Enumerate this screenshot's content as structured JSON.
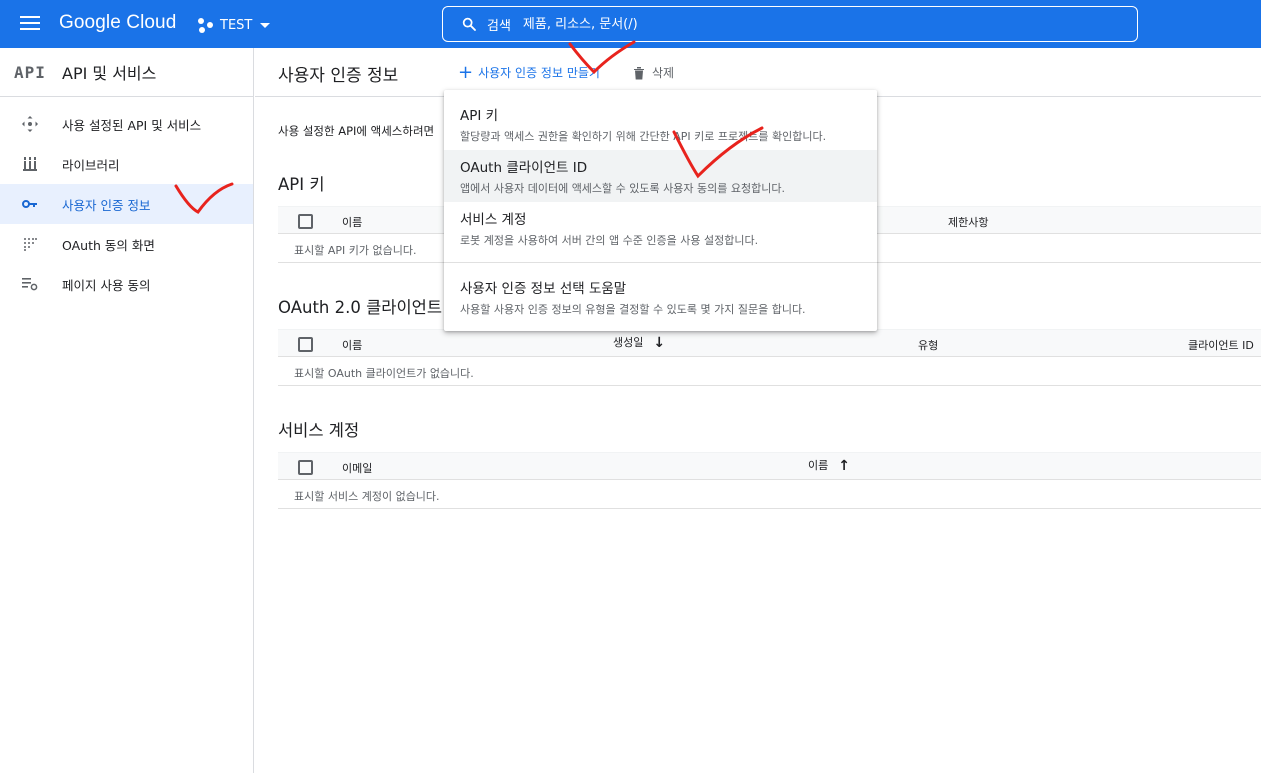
{
  "topbar": {
    "logo": "Google Cloud",
    "project": "TEST",
    "search_label": "검색",
    "search_placeholder": "제품, 리소스, 문서(/)"
  },
  "sidebar": {
    "logo_text": "API",
    "title": "API 및 서비스",
    "items": [
      {
        "label": "사용 설정된 API 및 서비스",
        "icon": "services-icon"
      },
      {
        "label": "라이브러리",
        "icon": "library-icon"
      },
      {
        "label": "사용자 인증 정보",
        "icon": "key-icon",
        "active": true
      },
      {
        "label": "OAuth 동의 화면",
        "icon": "oauth-consent-icon"
      },
      {
        "label": "페이지 사용 동의",
        "icon": "page-usage-icon"
      }
    ]
  },
  "main": {
    "title": "사용자 인증 정보",
    "create_label": "사용자 인증 정보 만들기",
    "delete_label": "삭제",
    "intro": "사용 설정한 API에 액세스하려면",
    "api_keys": {
      "title": "API 키",
      "columns": [
        "이름",
        "제한사항"
      ],
      "empty": "표시할 API 키가 없습니다."
    },
    "oauth": {
      "title": "OAuth 2.0 클라이언트",
      "columns": [
        "이름",
        "생성일",
        "유형",
        "클라이언트 ID"
      ],
      "empty": "표시할 OAuth 클라이언트가 없습니다."
    },
    "service_accounts": {
      "title": "서비스 계정",
      "columns": [
        "이메일",
        "이름"
      ],
      "empty": "표시할 서비스 계정이 없습니다."
    }
  },
  "menu": {
    "items": [
      {
        "title": "API 키",
        "desc": "할당량과 액세스 권한을 확인하기 위해 간단한 API 키로 프로젝트를 확인합니다."
      },
      {
        "title": "OAuth 클라이언트 ID",
        "desc": "앱에서 사용자 데이터에 액세스할 수 있도록 사용자 동의를 요청합니다."
      },
      {
        "title": "서비스 계정",
        "desc": "로봇 계정을 사용하여 서버 간의 앱 수준 인증을 사용 설정합니다."
      },
      {
        "title": "사용자 인증 정보 선택 도움말",
        "desc": "사용할 사용자 인증 정보의 유형을 결정할 수 있도록 몇 가지 질문을 합니다."
      }
    ]
  },
  "colors": {
    "brand": "#1a73e8",
    "active_bg": "#e8f0fe",
    "annotation": "#e8231d"
  }
}
